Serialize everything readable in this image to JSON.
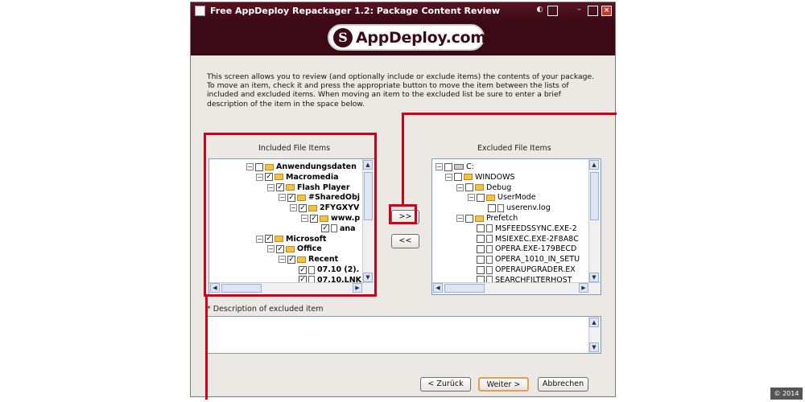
{
  "window": {
    "title": "Free AppDeploy Repackager 1.2: Package Content Review",
    "titlebar_buttons": [
      "toggle-icon",
      "restore-icon",
      "minimize-icon",
      "maximize-icon",
      "close-icon"
    ]
  },
  "banner": {
    "logo_mark": "S",
    "logo_text": "AppDeploy.com"
  },
  "intro_text": "This screen allows you to review (and optionally include or exclude items) the contents of your package. To move an item, check it and press the appropriate button to move the item between the lists of included and excluded items. When moving an item to the excluded list be sure to enter a brief description of the item in the space below.",
  "included": {
    "label": "Included File Items",
    "items": [
      {
        "label": "Anwendungsdaten",
        "checked": false,
        "bold": true
      },
      {
        "label": "Macromedia",
        "checked": true,
        "bold": true
      },
      {
        "label": "Flash Player",
        "checked": true,
        "bold": true
      },
      {
        "label": "#SharedObj",
        "checked": true,
        "bold": true
      },
      {
        "label": "2FYGXYV",
        "checked": true,
        "bold": true
      },
      {
        "label": "www.p",
        "checked": true,
        "bold": true
      },
      {
        "label": "ana",
        "checked": true,
        "bold": true
      },
      {
        "label": "Microsoft",
        "checked": true,
        "bold": true
      },
      {
        "label": "Office",
        "checked": true,
        "bold": true
      },
      {
        "label": "Recent",
        "checked": true,
        "bold": true
      },
      {
        "label": "07.10 (2).",
        "checked": true,
        "bold": true
      },
      {
        "label": "07.10.LNK",
        "checked": true,
        "bold": true
      }
    ]
  },
  "excluded": {
    "label": "Excluded File Items",
    "items": [
      {
        "label": "C:",
        "checked": false,
        "bold": false
      },
      {
        "label": "WINDOWS",
        "checked": false,
        "bold": false
      },
      {
        "label": "Debug",
        "checked": false,
        "bold": false
      },
      {
        "label": "UserMode",
        "checked": false,
        "bold": false
      },
      {
        "label": "userenv.log",
        "checked": false,
        "bold": false
      },
      {
        "label": "Prefetch",
        "checked": false,
        "bold": false
      },
      {
        "label": "MSFEEDSSYNC.EXE-2",
        "checked": false,
        "bold": false
      },
      {
        "label": "MSIEXEC.EXE-2F8A8C",
        "checked": false,
        "bold": false
      },
      {
        "label": "OPERA.EXE-179BECD",
        "checked": false,
        "bold": false
      },
      {
        "label": "OPERA_1010_IN_SETU",
        "checked": false,
        "bold": false
      },
      {
        "label": "OPERAUPGRADER.EX",
        "checked": false,
        "bold": false
      },
      {
        "label": "SEARCHFILTERHOST",
        "checked": false,
        "bold": false
      }
    ]
  },
  "move_buttons": {
    "to_excluded": ">>",
    "to_included": "<<"
  },
  "description": {
    "label": "* Description of excluded item",
    "value": ""
  },
  "footer": {
    "back": "< Zurück",
    "next": "Weiter >",
    "cancel": "Abbrechen"
  },
  "copyright": "© 2014",
  "colors": {
    "titlebar": "#3c0a16",
    "highlight": "#d4001a",
    "window_bg": "#ece9e4"
  }
}
